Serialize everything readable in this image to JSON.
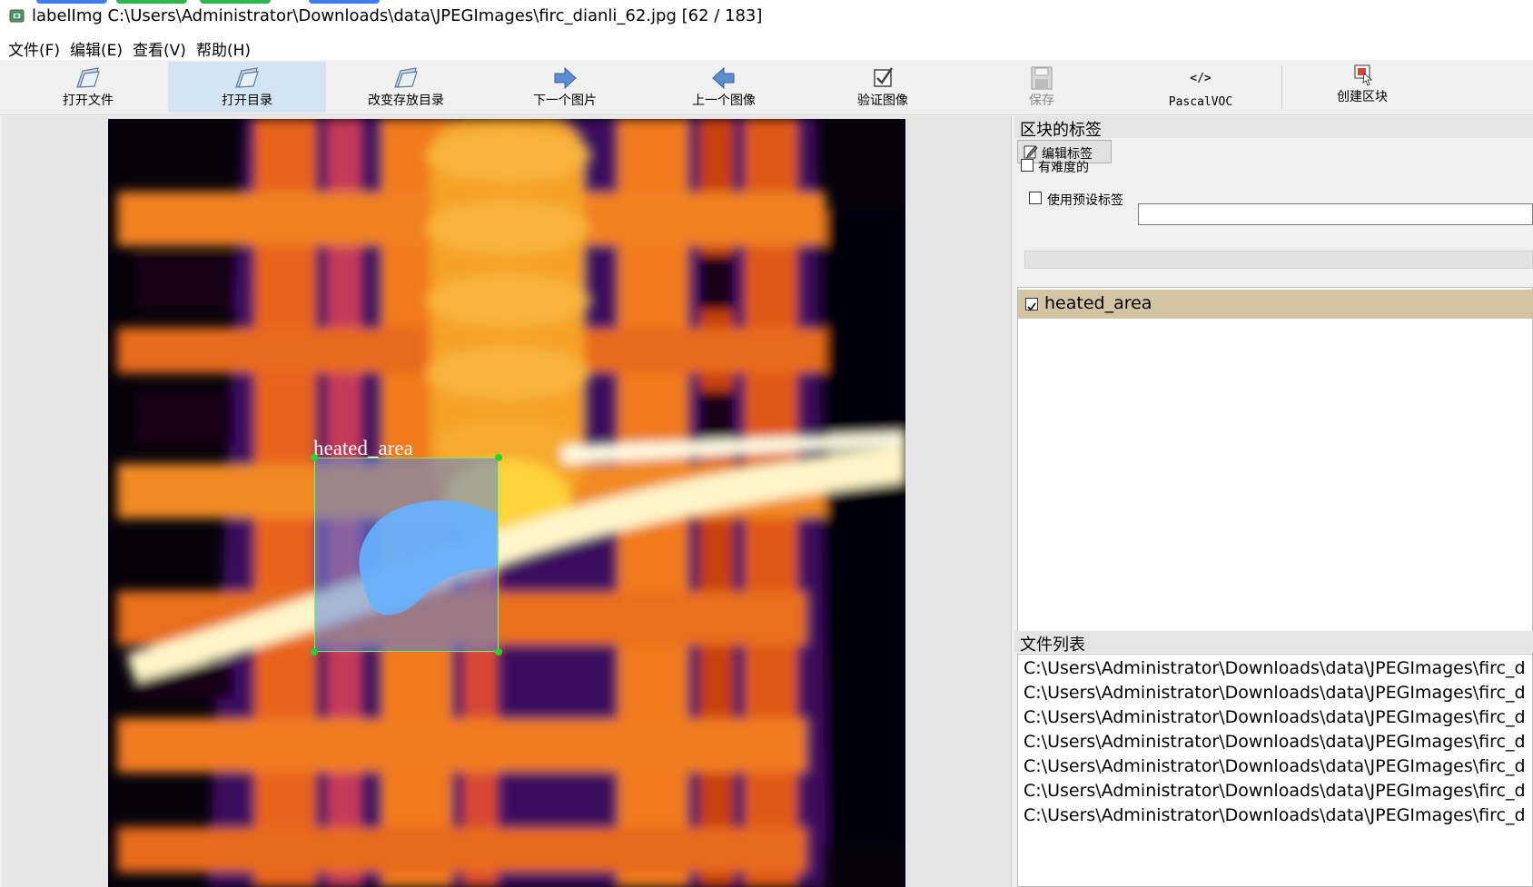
{
  "window": {
    "title": "labelImg C:\\Users\\Administrator\\Downloads\\data\\JPEGImages\\firc_dianli_62.jpg [62 / 183]"
  },
  "menu": {
    "file": "文件(F)",
    "edit": "编辑(E)",
    "view": "查看(V)",
    "help": "帮助(H)"
  },
  "toolbar": {
    "open_file": "打开文件",
    "open_dir": "打开目录",
    "change_save_dir": "改变存放目录",
    "next_image": "下一个图片",
    "prev_image": "上一个图像",
    "verify_image": "验证图像",
    "save": "保存",
    "format": "PascalVOC",
    "create_box": "创建区块"
  },
  "canvas": {
    "box_label": "heated_area"
  },
  "dock": {
    "box_labels_title": "区块的标签",
    "edit_label_button": "编辑标签",
    "difficult_label": "有难度的",
    "difficult_checked": false,
    "use_default_label": "使用预设标签",
    "use_default_checked": false,
    "default_label_value": "",
    "labels": [
      {
        "name": "heated_area",
        "checked": true
      }
    ],
    "file_list_title": "文件列表",
    "files": [
      "C:\\Users\\Administrator\\Downloads\\data\\JPEGImages\\firc_d",
      "C:\\Users\\Administrator\\Downloads\\data\\JPEGImages\\firc_d",
      "C:\\Users\\Administrator\\Downloads\\data\\JPEGImages\\firc_d",
      "C:\\Users\\Administrator\\Downloads\\data\\JPEGImages\\firc_d",
      "C:\\Users\\Administrator\\Downloads\\data\\JPEGImages\\firc_d",
      "C:\\Users\\Administrator\\Downloads\\data\\JPEGImages\\firc_d",
      "C:\\Users\\Administrator\\Downloads\\data\\JPEGImages\\firc_d"
    ]
  },
  "colors": {
    "label_row_selected": "#d3c5a3",
    "active_tool": "#d5e4f2",
    "box_fill": "#5a82dc",
    "box_border": "#6aff6a"
  }
}
